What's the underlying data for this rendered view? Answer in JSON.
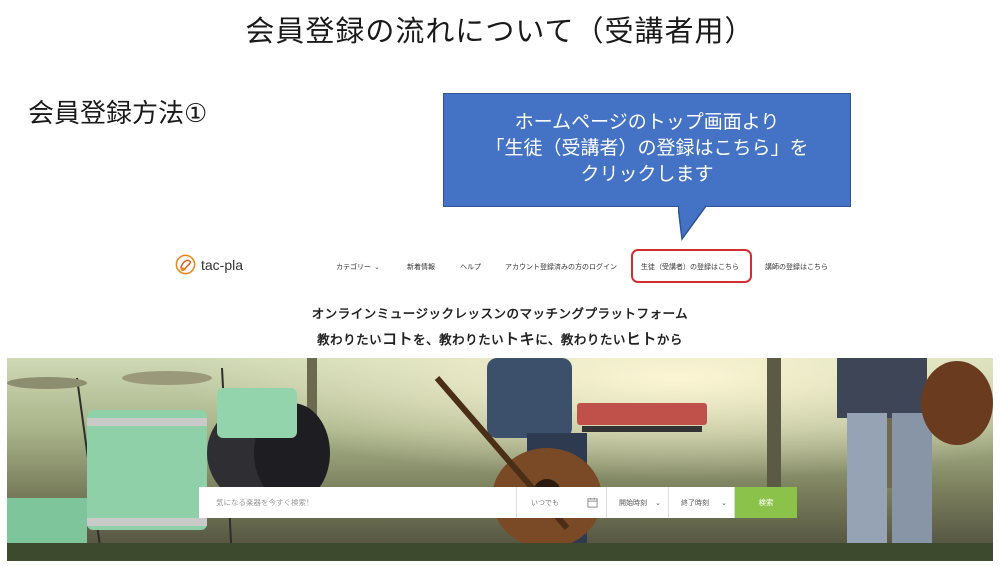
{
  "slide": {
    "title": "会員登録の流れについて（受講者用）",
    "section": "会員登録方法①"
  },
  "callout": {
    "line1": "ホームページのトップ画面より",
    "line2": "「生徒（受講者）の登録はこちら」を",
    "line3": "クリックします",
    "color": "#4472c4"
  },
  "site": {
    "logo_text": "tac-pla",
    "logo_icon": "tac-pla-logo-icon",
    "nav": {
      "category": "カテゴリー",
      "news": "新着情報",
      "help": "ヘルプ",
      "login": "アカウント登録済みの方のログイン",
      "student_register": "生徒（受講者）の登録はこちら",
      "teacher_register": "講師の登録はこちら"
    },
    "highlight_color": "#d32f2f",
    "tagline1": "オンラインミュージックレッスンのマッチングプラットフォーム",
    "tagline2": {
      "a": "教わりたい",
      "b": "コト",
      "c": "を、教わりたい",
      "d": "トキ",
      "e": "に、教わりたい",
      "f": "ヒト",
      "g": "から"
    },
    "search": {
      "placeholder": "気になる楽器を今すぐ検索！",
      "date": "いつでも",
      "date_icon": "calendar-icon",
      "start_time": "開始時刻",
      "end_time": "終了時刻",
      "button": "検索",
      "button_color": "#8bc34a"
    }
  }
}
